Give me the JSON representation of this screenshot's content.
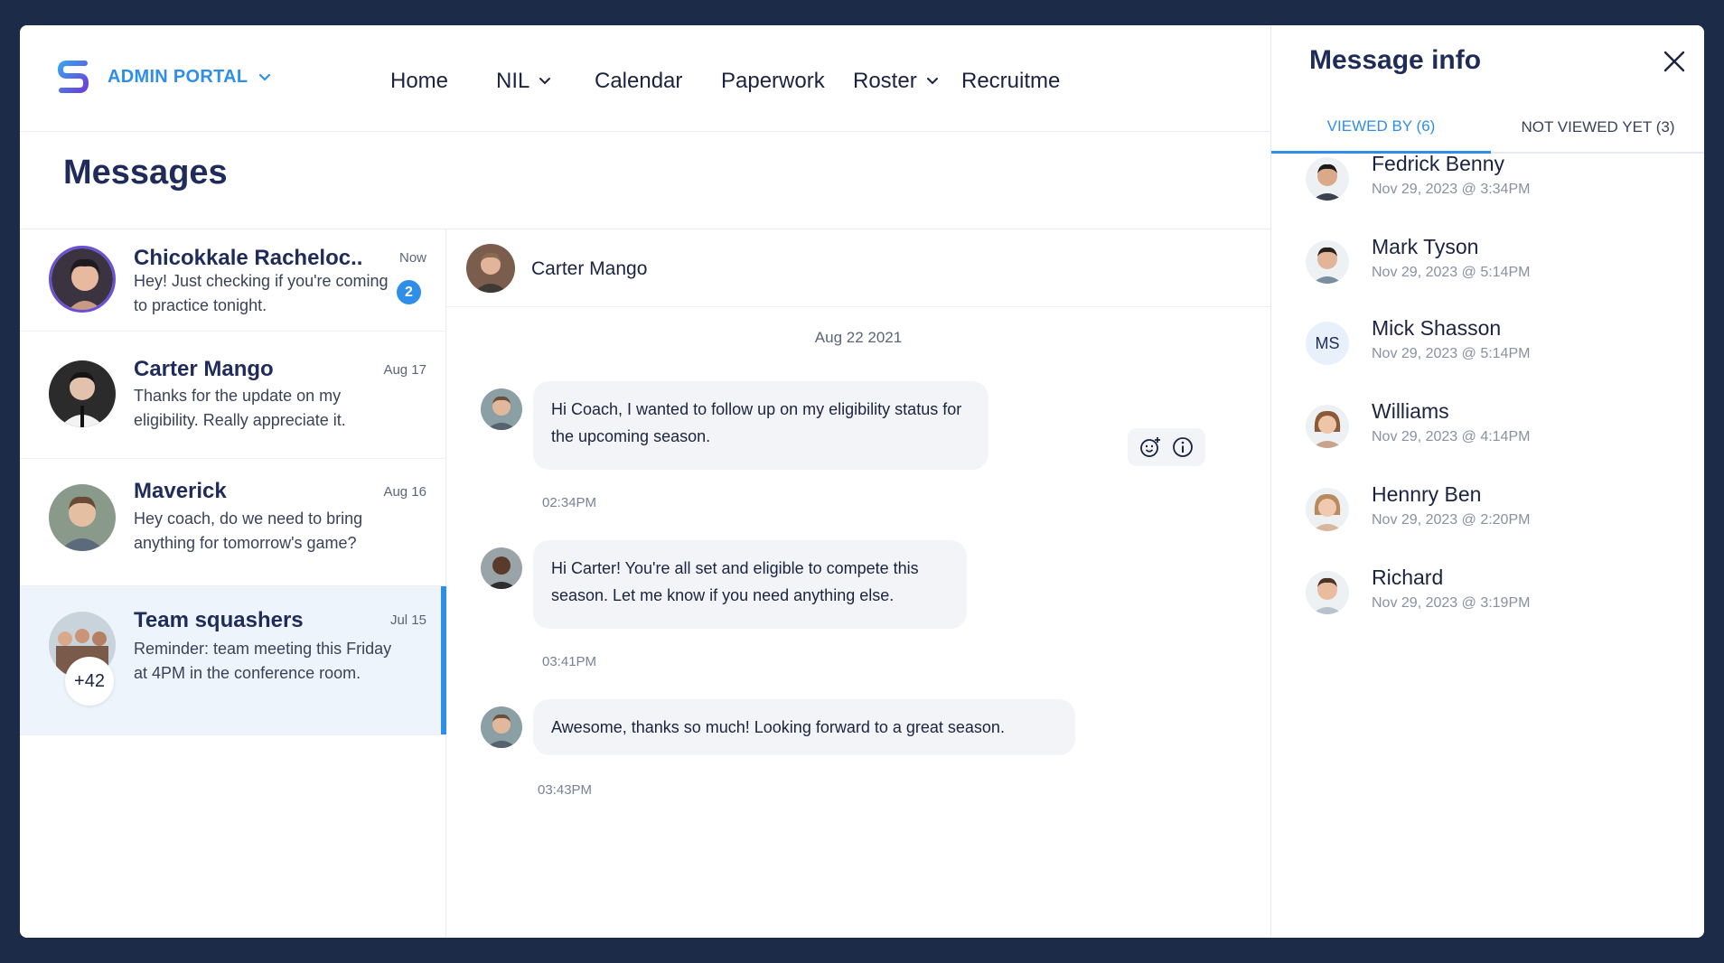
{
  "app": {
    "brand_label": "ADMIN PORTAL",
    "accent": "#2f8ee8"
  },
  "nav": {
    "items": [
      {
        "label": "Home",
        "dropdown": false
      },
      {
        "label": "NIL",
        "dropdown": true
      },
      {
        "label": "Calendar",
        "dropdown": false
      },
      {
        "label": "Paperwork",
        "dropdown": false
      },
      {
        "label": "Roster",
        "dropdown": true
      },
      {
        "label": "Recruitme",
        "dropdown": false
      }
    ]
  },
  "page": {
    "title": "Messages"
  },
  "conversations": [
    {
      "name": "Chicokkale Racheloc..",
      "time": "Now",
      "preview": "Hey! Just checking if you're coming to practice tonight.",
      "unread": "2",
      "active": false
    },
    {
      "name": "Carter Mango",
      "time": "Aug 17",
      "preview": "Thanks for the update on my eligibility. Really appreciate it.",
      "active": false
    },
    {
      "name": "Maverick",
      "time": "Aug 16",
      "preview": "Hey coach, do we need to bring anything for tomorrow's game?",
      "active": false
    },
    {
      "name": "Team squashers",
      "time": "Jul 15",
      "preview": "Reminder: team meeting this Friday at 4PM in the conference room.",
      "members_extra": "+42",
      "active": true
    }
  ],
  "chat": {
    "contact_name": "Carter Mango",
    "date_separator": "Aug 22 2021",
    "messages": [
      {
        "text": "Hi Coach, I wanted to follow up on my eligibility status for the upcoming season.",
        "time": "02:34PM",
        "sender": "Carter Mango"
      },
      {
        "text": "Hi Carter! You're all set and eligible to compete this season. Let me know if you need anything else.",
        "time": "03:41PM",
        "sender": "Coach"
      },
      {
        "text": "Awesome, thanks so much! Looking forward to a great season.",
        "time": "03:43PM",
        "sender": "Carter Mango"
      }
    ],
    "message_actions": [
      "add-reaction-icon",
      "info-icon"
    ]
  },
  "message_info": {
    "title": "Message info",
    "tabs": [
      {
        "label": "VIEWED BY (6)",
        "active": true
      },
      {
        "label": "NOT VIEWED YET (3)",
        "active": false
      }
    ],
    "viewers": [
      {
        "name": "Fedrick Benny",
        "time": "Nov 29, 2023 @ 3:34PM"
      },
      {
        "name": "Mark Tyson",
        "time": "Nov 29, 2023 @ 5:14PM"
      },
      {
        "name": "Mick Shasson",
        "time": "Nov 29, 2023 @ 5:14PM",
        "initials": "MS"
      },
      {
        "name": "Williams",
        "time": "Nov 29, 2023 @ 4:14PM"
      },
      {
        "name": "Hennry Ben",
        "time": "Nov 29, 2023 @ 2:20PM"
      },
      {
        "name": "Richard",
        "time": "Nov 29, 2023 @ 3:19PM"
      }
    ]
  }
}
